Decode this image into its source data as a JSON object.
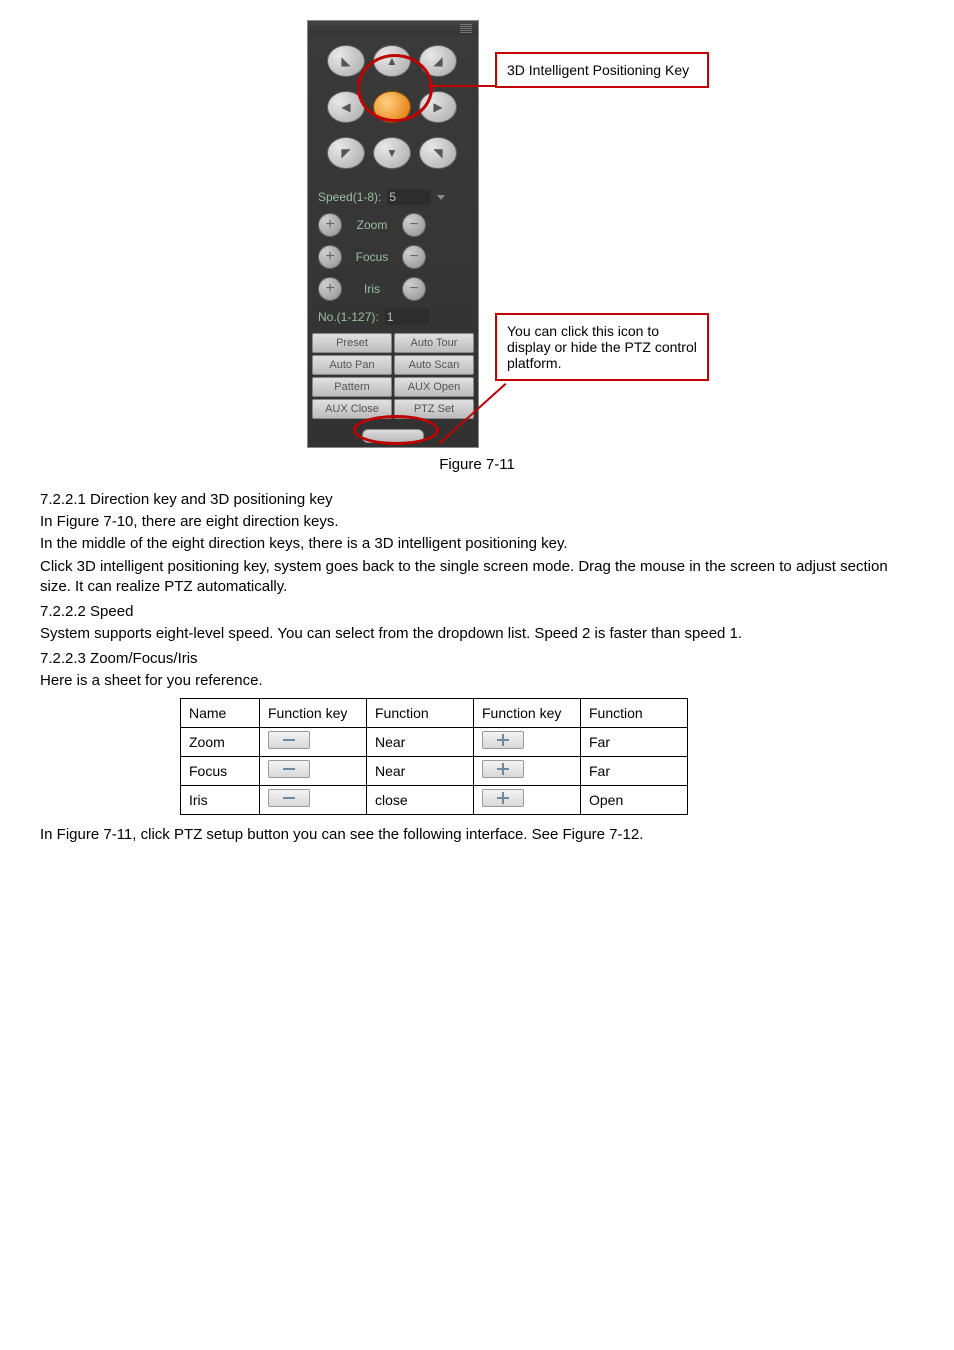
{
  "figure": {
    "caption": "Figure 7-11",
    "callout_top": "3D Intelligent Positioning Key",
    "callout_bottom": "You can click this icon to display or hide the PTZ control platform.",
    "speed_label": "Speed(1-8):",
    "speed_value": "5",
    "controls": {
      "zoom": "Zoom",
      "focus": "Focus",
      "iris": "Iris"
    },
    "no_label": "No.(1-127):",
    "no_value": "1",
    "buttons": [
      "Preset",
      "Auto Tour",
      "Auto Pan",
      "Auto Scan",
      "Pattern",
      "AUX Open",
      "AUX Close",
      "PTZ Set"
    ]
  },
  "sections": {
    "s1_heading": "7.2.2.1  Direction key and 3D positioning key",
    "s1_lines": [
      "In Figure 7-10, there are eight direction keys.",
      "In the middle of the eight direction keys, there is a 3D intelligent positioning key.",
      "Click 3D intelligent positioning key, system goes back to the single screen mode. Drag the mouse in the screen to adjust section size. It can realize PTZ automatically."
    ],
    "s2_heading": "7.2.2.2  Speed",
    "s2_lines": [
      "System supports eight-level speed. You can select from the dropdown list. Speed 2 is faster than speed 1."
    ],
    "s3_heading": "7.2.2.3  Zoom/Focus/Iris",
    "s3_intro": "Here is a sheet for you reference."
  },
  "table": {
    "headers": [
      "Name",
      "Function key",
      "Function",
      "Function key",
      "Function"
    ],
    "rows": [
      {
        "name": "Zoom",
        "f1": "Near",
        "f2": "Far"
      },
      {
        "name": "Focus",
        "f1": "Near",
        "f2": "Far"
      },
      {
        "name": "Iris",
        "f1": "close",
        "f2": "Open"
      }
    ]
  },
  "footer_line": "In Figure 7-11, click PTZ setup button you can see the following interface. See Figure 7-12."
}
